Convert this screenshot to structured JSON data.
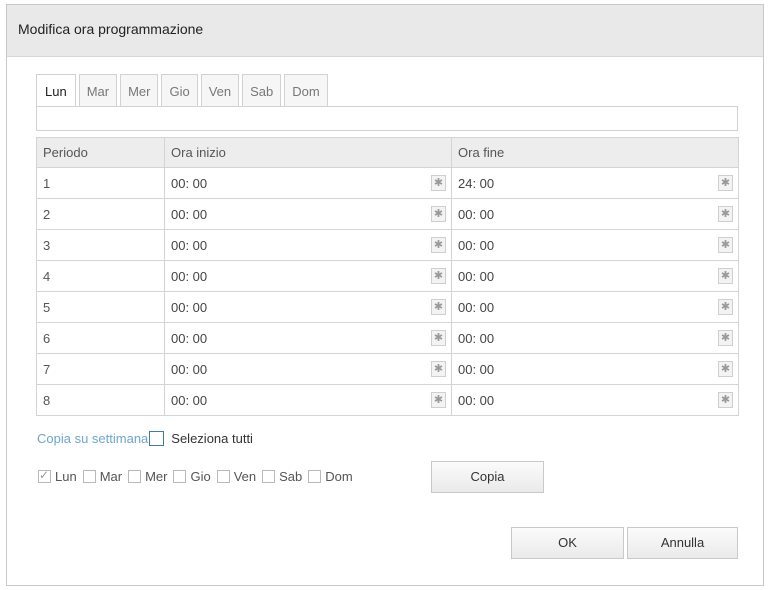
{
  "dialog": {
    "title": "Modifica ora programmazione"
  },
  "tabs": [
    {
      "label": "Lun",
      "active": true
    },
    {
      "label": "Mar",
      "active": false
    },
    {
      "label": "Mer",
      "active": false
    },
    {
      "label": "Gio",
      "active": false
    },
    {
      "label": "Ven",
      "active": false
    },
    {
      "label": "Sab",
      "active": false
    },
    {
      "label": "Dom",
      "active": false
    }
  ],
  "table": {
    "headers": {
      "period": "Periodo",
      "start": "Ora inizio",
      "end": "Ora fine"
    },
    "rows": [
      {
        "period": "1",
        "start": "00: 00",
        "end": "24: 00"
      },
      {
        "period": "2",
        "start": "00: 00",
        "end": "00: 00"
      },
      {
        "period": "3",
        "start": "00: 00",
        "end": "00: 00"
      },
      {
        "period": "4",
        "start": "00: 00",
        "end": "00: 00"
      },
      {
        "period": "5",
        "start": "00: 00",
        "end": "00: 00"
      },
      {
        "period": "6",
        "start": "00: 00",
        "end": "00: 00"
      },
      {
        "period": "7",
        "start": "00: 00",
        "end": "00: 00"
      },
      {
        "period": "8",
        "start": "00: 00",
        "end": "00: 00"
      }
    ],
    "clock_icon": "clock-picker-icon"
  },
  "copy": {
    "link_label": "Copia su settimana",
    "select_all_label": "Seleziona tutti",
    "select_all_checked": false,
    "days": [
      {
        "label": "Lun",
        "checked": true
      },
      {
        "label": "Mar",
        "checked": false
      },
      {
        "label": "Mer",
        "checked": false
      },
      {
        "label": "Gio",
        "checked": false
      },
      {
        "label": "Ven",
        "checked": false
      },
      {
        "label": "Sab",
        "checked": false
      },
      {
        "label": "Dom",
        "checked": false
      }
    ],
    "copy_button": "Copia"
  },
  "footer": {
    "ok_label": "OK",
    "cancel_label": "Annulla"
  },
  "colors": {
    "link": "#6ea6cf",
    "header_bg": "#e9e9e9",
    "checkbox_focus": "#3f79b8"
  }
}
